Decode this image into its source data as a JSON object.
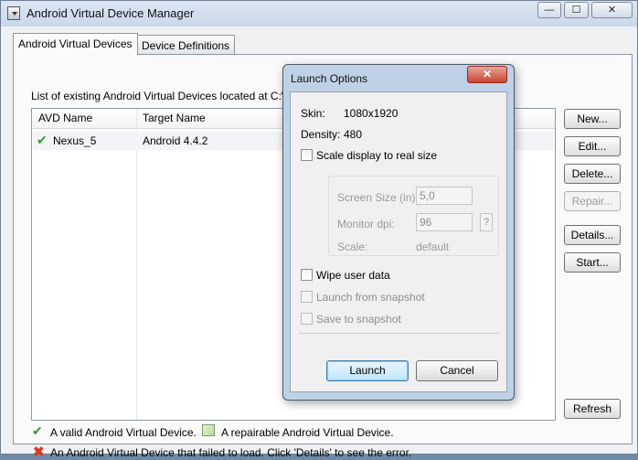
{
  "window": {
    "title": "Android Virtual Device Manager",
    "min_glyph": "—",
    "max_glyph": "☐",
    "close_glyph": "✕",
    "icon": "android-download-icon"
  },
  "tabs": [
    {
      "label": "Android Virtual Devices",
      "selected": true
    },
    {
      "label": "Device Definitions",
      "selected": false
    }
  ],
  "main": {
    "list_label": "List of existing Android Virtual Devices located at C:\\U",
    "columns": [
      "AVD Name",
      "Target Name"
    ],
    "rows": [
      {
        "name": "Nexus_5",
        "target": "Android 4.4.2",
        "status_icon": "valid-check-icon"
      }
    ]
  },
  "side_buttons": {
    "new": "New...",
    "edit": "Edit...",
    "delete": "Delete...",
    "repair": "Repair...",
    "details": "Details...",
    "start": "Start...",
    "refresh": "Refresh"
  },
  "legend": {
    "valid": "A valid Android Virtual Device.",
    "repairable": "A repairable Android Virtual Device.",
    "failed": "An Android Virtual Device that failed to load. Click 'Details' to see the error."
  },
  "dialog": {
    "title": "Launch Options",
    "close_glyph": "✕",
    "skin_label": "Skin:",
    "skin_value": "1080x1920",
    "density_label": "Density:",
    "density_value": "480",
    "scale_checkbox": "Scale display to real size",
    "screen_size_label": "Screen Size (in):",
    "screen_size_value": "5,0",
    "monitor_dpi_label": "Monitor dpi:",
    "monitor_dpi_value": "96",
    "help_button": "?",
    "scale_label": "Scale:",
    "scale_value": "default",
    "wipe_checkbox": "Wipe user data",
    "launch_snapshot_checkbox": "Launch from snapshot",
    "save_snapshot_checkbox": "Save to snapshot",
    "launch_button": "Launch",
    "cancel_button": "Cancel"
  },
  "colors": {
    "valid": "#2e9b2e",
    "failed": "#d73b25",
    "default_button_border": "#3c7fb1"
  }
}
